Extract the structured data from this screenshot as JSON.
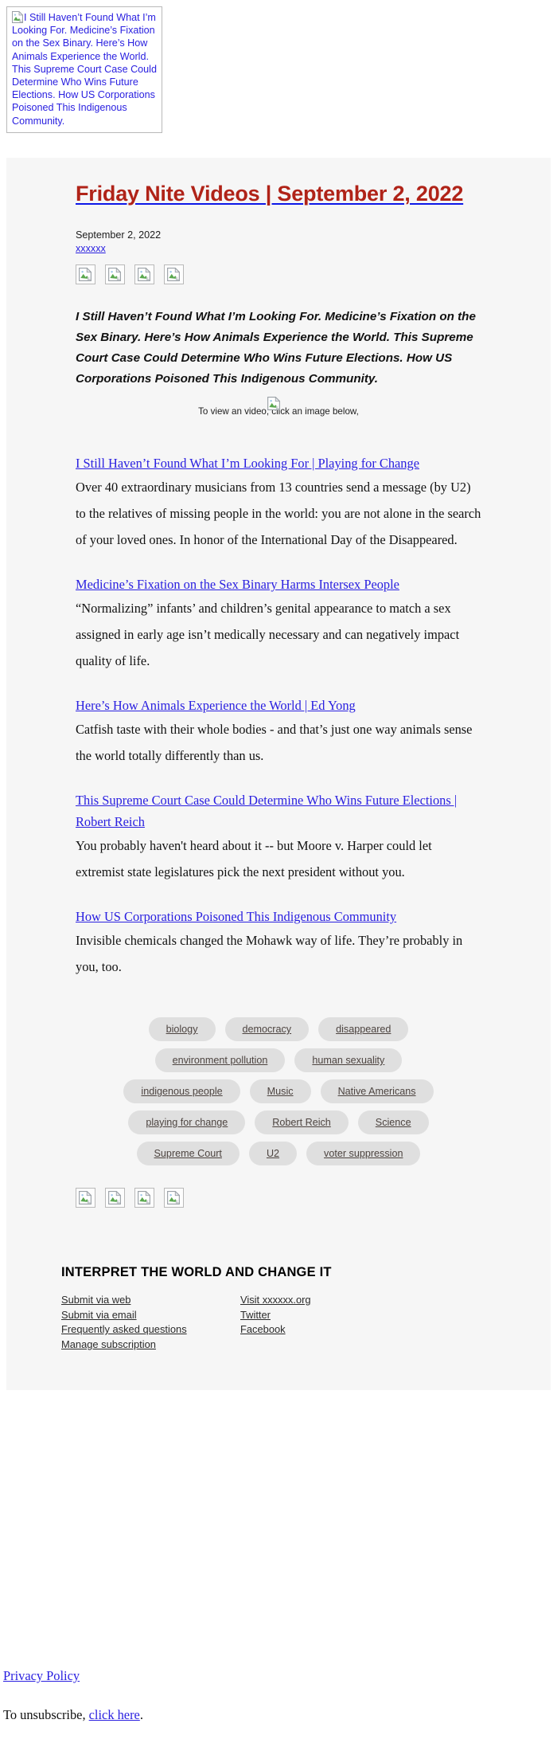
{
  "preheader": {
    "alt_text": "I Still Haven’t Found What I’m Looking For. Medicine’s Fixation on the Sex Binary. Here’s How Animals Experience the World. This Supreme Court Case Could Determine Who Wins Future Elections. How US Corporations Poisoned This Indigenous Community.",
    "broken_image_icon": "broken-image-icon"
  },
  "header": {
    "title": "Friday Nite Videos | September 2, 2022",
    "title_color": "#b02318",
    "underline_color": "#0d18e8",
    "date": "September 2, 2022",
    "source_label": "xxxxxx"
  },
  "top_icons": [
    "broken-image-icon",
    "broken-image-icon",
    "broken-image-icon",
    "broken-image-icon"
  ],
  "lede": "I Still Haven’t Found What I’m Looking For. Medicine’s Fixation on the Sex Binary. Here’s How Animals Experience the World. This Supreme Court Case Could Determine Who Wins Future Elections. How US Corporations Poisoned This Indigenous Community.",
  "view_note": "To view an video, click an image below,",
  "articles": [
    {
      "link": "I Still Haven’t Found What I’m Looking For | Playing for Change",
      "description": "Over 40 extraordinary musicians from 13 countries send a message (by U2) to the relatives of missing people in the world: you are not alone in the search of your loved ones. In honor of the International Day of the Disappeared."
    },
    {
      "link": "Medicine’s Fixation on the Sex Binary Harms Intersex People",
      "description": "“Normalizing” infants’ and children’s genital appearance to match a sex assigned in early age isn’t medically necessary and can negatively impact quality of life."
    },
    {
      "link": "Here’s How Animals Experience the World | Ed Yong",
      "description": "Catfish taste with their whole bodies - and that’s just one way animals sense the world totally differently than us."
    },
    {
      "link": "This Supreme Court Case Could Determine Who Wins Future Elections | Robert Reich",
      "description": "You probably haven't heard about it -- but Moore v. Harper could let extremist state legislatures pick the next president without you."
    },
    {
      "link": "How US Corporations Poisoned This Indigenous Community",
      "description": "Invisible chemicals changed the Mohawk way of life. They’re probably in you, too."
    }
  ],
  "tags": [
    "biology",
    "democracy",
    "disappeared",
    "environment pollution",
    "human sexuality",
    "indigenous people",
    "Music",
    "Native Americans",
    "playing for change",
    "Robert Reich",
    "Science",
    "Supreme Court",
    "U2",
    "voter suppression"
  ],
  "tag_style": {
    "background": "#dfdfdf",
    "text_color": "#4d4440"
  },
  "bottom_icons": [
    "broken-image-icon",
    "broken-image-icon",
    "broken-image-icon",
    "broken-image-icon"
  ],
  "footer": {
    "heading": "INTERPRET THE WORLD AND CHANGE IT",
    "left_links": [
      "Submit via web",
      "Submit via email",
      "Frequently asked questions",
      "Manage subscription"
    ],
    "right_links": [
      "Visit xxxxxx.org",
      "Twitter",
      "Facebook"
    ]
  },
  "bottom": {
    "privacy_policy": "Privacy Policy",
    "unsubscribe_prefix": "To unsubscribe, ",
    "unsubscribe_link": "click here",
    "unsubscribe_suffix": "."
  }
}
